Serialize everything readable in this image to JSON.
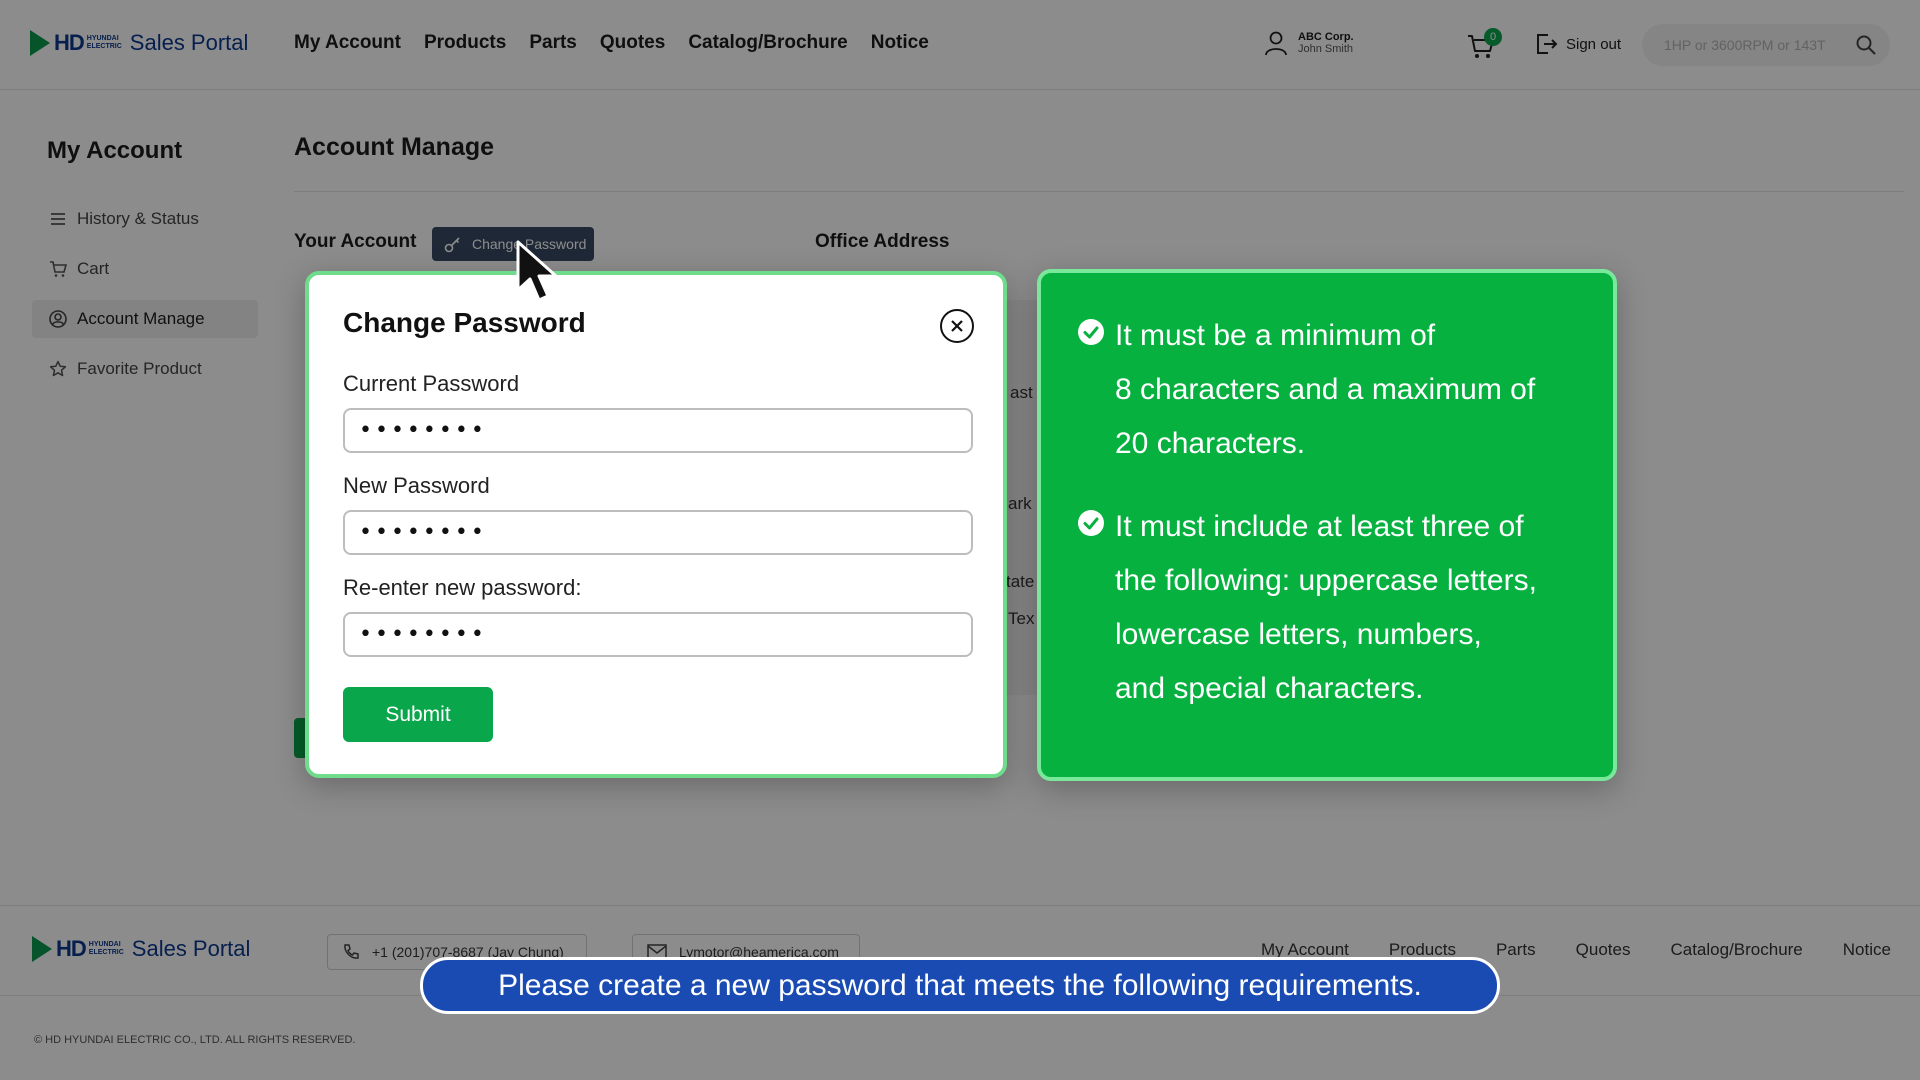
{
  "header": {
    "logo": {
      "mark": "HD",
      "sub_line1": "HYUNDAI",
      "sub_line2": "ELECTRIC",
      "portal": "Sales Portal"
    },
    "nav": [
      "My Account",
      "Products",
      "Parts",
      "Quotes",
      "Catalog/Brochure",
      "Notice"
    ],
    "user": {
      "company": "ABC Corp.",
      "name": "John Smith",
      "icon": "user-icon"
    },
    "cart": {
      "count": "0",
      "icon": "cart-icon"
    },
    "signout": {
      "label": "Sign out",
      "icon": "sign-out-icon"
    },
    "search": {
      "placeholder": "1HP or 3600RPM or 143T",
      "value": "",
      "icon": "search-icon"
    }
  },
  "sidebar": {
    "title": "My Account",
    "items": [
      {
        "label": "History & Status",
        "icon": "list-icon",
        "active": false
      },
      {
        "label": "Cart",
        "icon": "cart-icon",
        "active": false
      },
      {
        "label": "Account Manage",
        "icon": "user-circle-icon",
        "active": true
      },
      {
        "label": "Favorite Product",
        "icon": "star-icon",
        "active": false
      }
    ]
  },
  "main": {
    "title": "Account Manage",
    "your_account": "Your Account",
    "change_password_button": "Change Password",
    "office_address": "Office Address",
    "partial_fragments": [
      "ast",
      "ark",
      "tate",
      "Tex"
    ]
  },
  "modal": {
    "title": "Change Password",
    "fields": [
      {
        "label": "Current Password",
        "value": "••••••••"
      },
      {
        "label": "New Password",
        "value": "••••••••"
      },
      {
        "label": "Re-enter new password:",
        "value": "••••••••"
      }
    ],
    "submit_label": "Submit",
    "close_icon": "close-icon"
  },
  "requirements": {
    "items": [
      {
        "lines": [
          "It must be a minimum of",
          "8 characters and a maximum of",
          "20 characters."
        ],
        "icon": "check-circle-icon"
      },
      {
        "lines": [
          "It must include at least three of",
          "the following: uppercase letters,",
          "lowercase letters, numbers,",
          "and special characters."
        ],
        "icon": "check-circle-icon"
      }
    ]
  },
  "footer": {
    "portal": "Sales Portal",
    "phone": "+1 (201)707-8687 (Jay Chung)",
    "email": "Lymotor@heamerica.com",
    "nav": [
      "My Account",
      "Products",
      "Parts",
      "Quotes",
      "Catalog/Brochure",
      "Notice"
    ],
    "copyright": "© HD HYUNDAI ELECTRIC CO., LTD. ALL RIGHTS RESERVED."
  },
  "caption": "Please create a new password that meets the following requirements.",
  "colors": {
    "brand_green": "#0aa64c",
    "brand_blue": "#0e3a8f",
    "requirement_bg": "#06b140",
    "caption_bg": "#1a4bb3"
  }
}
